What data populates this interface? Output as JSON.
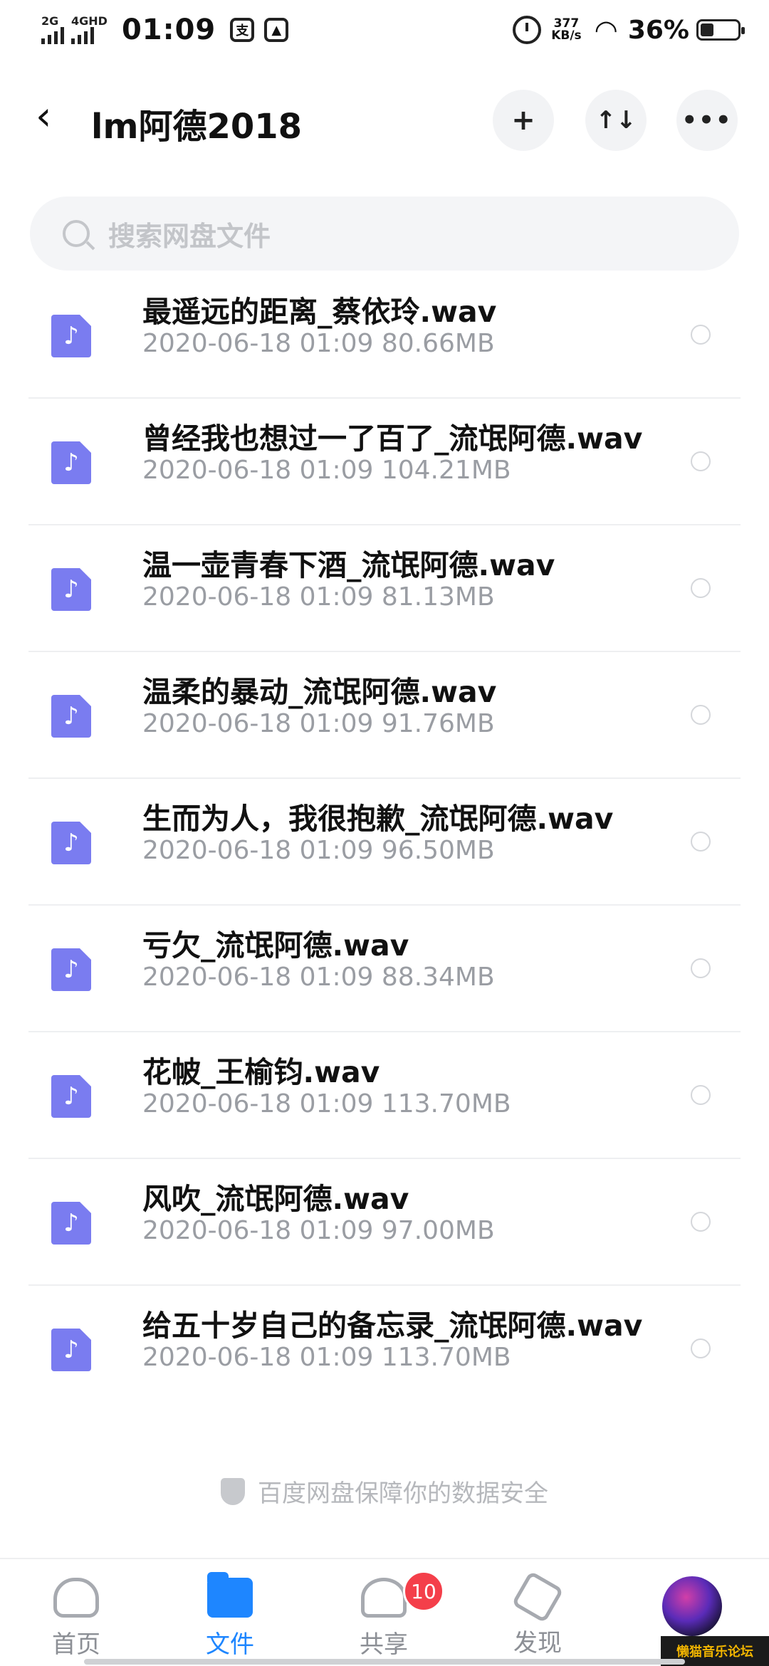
{
  "status_bar": {
    "net1": "2G",
    "net2": "4GHD",
    "time": "01:09",
    "speed_value": "377",
    "speed_unit": "KB/s",
    "battery_pct": "36%",
    "battery_level": 0.36
  },
  "header": {
    "title": "lm阿德2018",
    "add_label": "+",
    "sort_label": "↑↓",
    "more_label": "•••"
  },
  "search": {
    "placeholder": "搜索网盘文件"
  },
  "files": [
    {
      "name": "最遥远的距离_蔡依玲.wav",
      "meta": "2020-06-18  01:09  80.66MB"
    },
    {
      "name": "曾经我也想过一了百了_流氓阿德.wav",
      "meta": "2020-06-18  01:09  104.21MB"
    },
    {
      "name": "温一壶青春下酒_流氓阿德.wav",
      "meta": "2020-06-18  01:09  81.13MB"
    },
    {
      "name": "温柔的暴动_流氓阿德.wav",
      "meta": "2020-06-18  01:09  91.76MB"
    },
    {
      "name": "生而为人，我很抱歉_流氓阿德.wav",
      "meta": "2020-06-18  01:09  96.50MB"
    },
    {
      "name": "亏欠_流氓阿德.wav",
      "meta": "2020-06-18  01:09  88.34MB"
    },
    {
      "name": "花帔_王榆钧.wav",
      "meta": "2020-06-18  01:09  113.70MB"
    },
    {
      "name": "风吹_流氓阿德.wav",
      "meta": "2020-06-18  01:09  97.00MB"
    },
    {
      "name": "给五十岁自己的备忘录_流氓阿德.wav",
      "meta": "2020-06-18  01:09  113.70MB"
    }
  ],
  "footer_note": "百度网盘保障你的数据安全",
  "nav": {
    "home": "首页",
    "files": "文件",
    "share": "共享",
    "discover": "发现",
    "share_badge": "10"
  },
  "watermark": "懒猫音乐论坛",
  "colors": {
    "accent": "#1e86ff",
    "file_icon": "#7a7cf0",
    "badge": "#f43f4a"
  }
}
